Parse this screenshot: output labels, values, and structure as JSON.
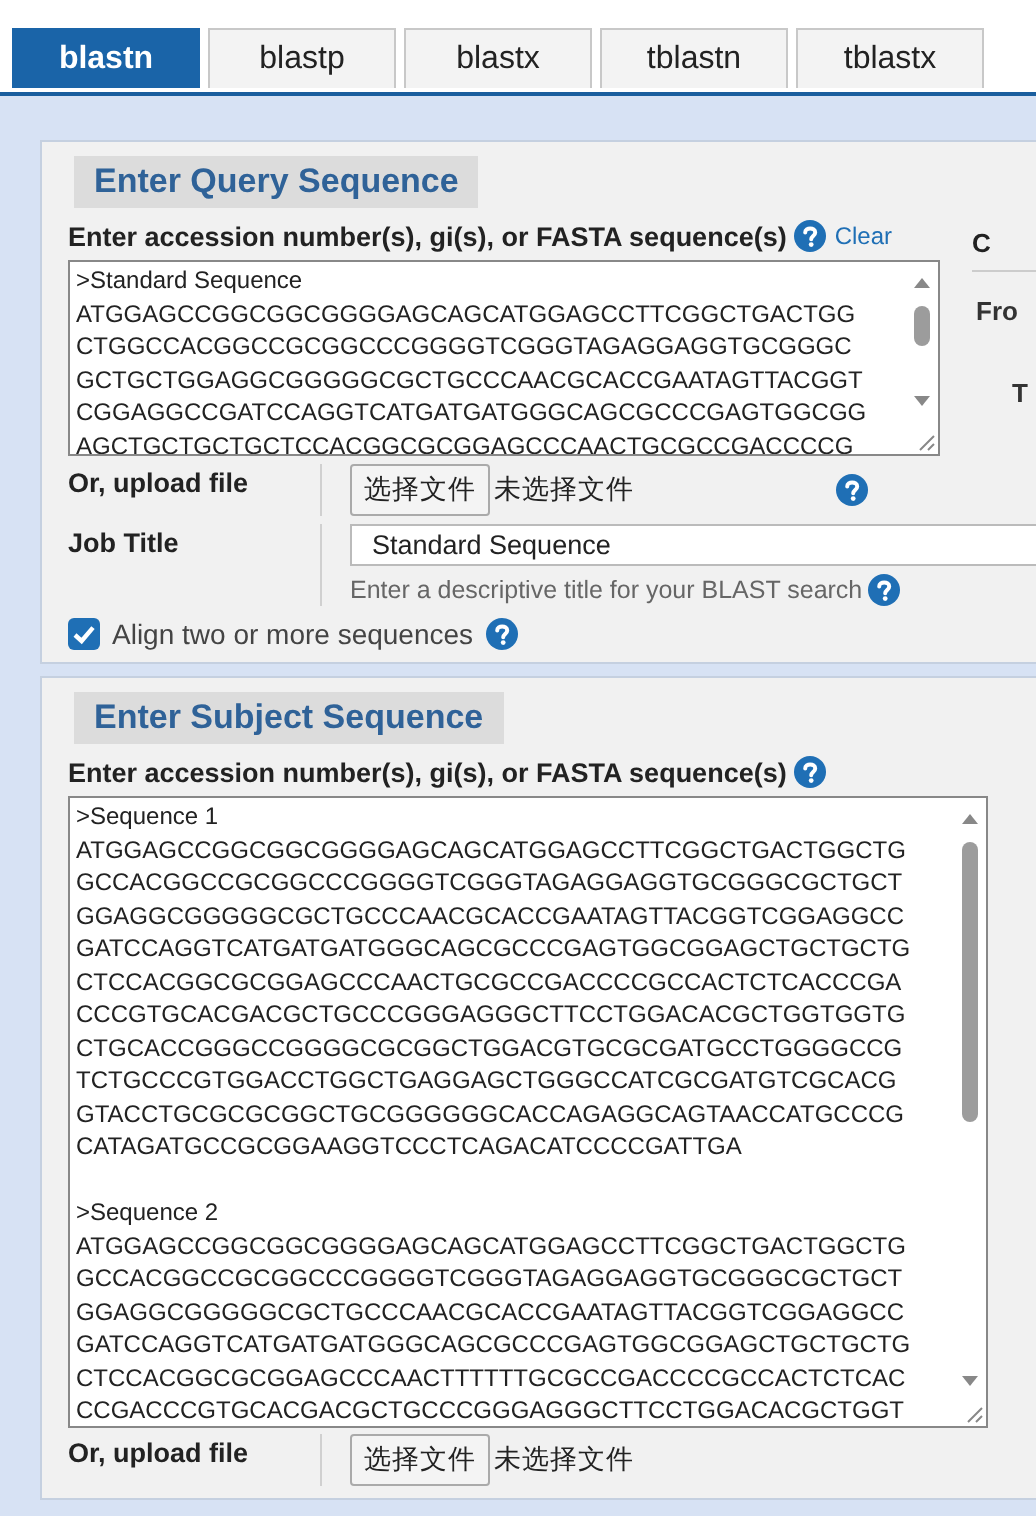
{
  "tabs": [
    {
      "label": "blastn",
      "selected": true
    },
    {
      "label": "blastp",
      "selected": false
    },
    {
      "label": "blastx",
      "selected": false
    },
    {
      "label": "tblastn",
      "selected": false
    },
    {
      "label": "tblastx",
      "selected": false
    }
  ],
  "query": {
    "legend": "Enter Query Sequence",
    "label": "Enter accession number(s), gi(s), or FASTA sequence(s)",
    "clear": "Clear",
    "lines": [
      ">Standard Sequence",
      "ATGGAGCCGGCGGCGGGGAGCAGCATGGAGCCTTCGGCTGACTGG",
      "CTGGCCACGGCCGCGGCCCGGGGTCGGGTAGAGGAGGTGCGGGC",
      "GCTGCTGGAGGCGGGGGCGCTGCCCAACGCACCGAATAGTTACGGT",
      "CGGAGGCCGATCCAGGTCATGATGATGGGCAGCGCCCGAGTGGCGG",
      "AGCTGCTGCTGCTCCACGGCGCGGAGCCCAACTGCGCCGACCCCG"
    ],
    "upload_label": "Or, upload file",
    "file_button": "选择文件",
    "file_status": "未选择文件",
    "job_title_label": "Job Title",
    "job_title_value": "Standard Sequence",
    "job_title_hint": "Enter a descriptive title for your BLAST search",
    "align": {
      "label": "Align two or more sequences",
      "checked": true
    },
    "side": {
      "heading": "C",
      "from": "Fro",
      "to": "T"
    }
  },
  "subject": {
    "legend": "Enter Subject Sequence",
    "label": "Enter accession number(s), gi(s), or FASTA sequence(s)",
    "blocks": [
      [
        ">Sequence 1",
        "ATGGAGCCGGCGGCGGGGAGCAGCATGGAGCCTTCGGCTGACTGGCTG",
        "GCCACGGCCGCGGCCCGGGGTCGGGTAGAGGAGGTGCGGGCGCTGCT",
        "GGAGGCGGGGGCGCTGCCCAACGCACCGAATAGTTACGGTCGGAGGCC",
        "GATCCAGGTCATGATGATGGGCAGCGCCCGAGTGGCGGAGCTGCTGCTG",
        "CTCCACGGCGCGGAGCCCAACTGCGCCGACCCCGCCACTCTCACCCGA",
        "CCCGTGCACGACGCTGCCCGGGAGGGCTTCCTGGACACGCTGGTGGTG",
        "CTGCACCGGGCCGGGGCGCGGCTGGACGTGCGCGATGCCTGGGGCCG",
        "TCTGCCCGTGGACCTGGCTGAGGAGCTGGGCCATCGCGATGTCGCACG",
        "GTACCTGCGCGCGGCTGCGGGGGGCACCAGAGGCAGTAACCATGCCCG",
        "CATAGATGCCGCGGAAGGTCCCTCAGACATCCCCGATTGA"
      ],
      [
        ">Sequence 2",
        "ATGGAGCCGGCGGCGGGGAGCAGCATGGAGCCTTCGGCTGACTGGCTG",
        "GCCACGGCCGCGGCCCGGGGTCGGGTAGAGGAGGTGCGGGCGCTGCT",
        "GGAGGCGGGGGCGCTGCCCAACGCACCGAATAGTTACGGTCGGAGGCC",
        "GATCCAGGTCATGATGATGGGCAGCGCCCGAGTGGCGGAGCTGCTGCTG",
        "CTCCACGGCGCGGAGCCCAACTTTTTTGCGCCGACCCCGCCACTCTCAC",
        "CCGACCCGTGCACGACGCTGCCCGGGAGGGCTTCCTGGACACGCTGGT"
      ]
    ],
    "upload_label": "Or, upload file",
    "file_button": "选择文件",
    "file_status": "未选择文件"
  }
}
